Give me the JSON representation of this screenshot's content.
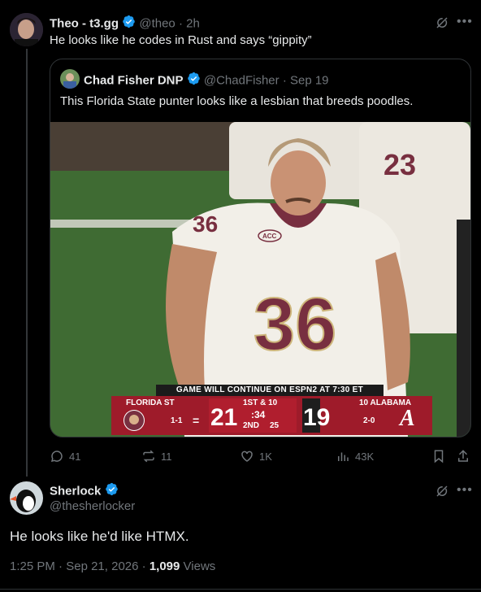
{
  "post": {
    "author_name": "Theo - t3.gg",
    "author_handle": "@theo",
    "separator": "·",
    "time": "2h",
    "text": "He looks like he codes in Rust and says “gippity”",
    "quote": {
      "author_name": "Chad Fisher DNP",
      "author_handle": "@ChadFisher",
      "separator": "·",
      "date": "Sep 19",
      "text": "This Florida State punter looks like a lesbian that breeds poodles.",
      "image": {
        "jersey_number": "36",
        "back_jersey_number": "23",
        "sleeve_number": "36",
        "patch": "ACC",
        "banner": "GAME WILL CONTINUE ON ESPN2 AT 7:30 ET",
        "scoreboard": {
          "home_team": "FLORIDA ST",
          "home_record": "1-1",
          "home_score": "21",
          "quarter": "1ST & 10",
          "clock": ":34",
          "period": "2ND",
          "play_clock": "25",
          "away_score": "19",
          "away_team": "10 ALABAMA",
          "away_record": "2-0",
          "away_logo_letter": "A"
        }
      }
    },
    "actions": {
      "replies": "41",
      "reposts": "11",
      "likes": "1K",
      "views": "43K"
    }
  },
  "reply": {
    "author_name": "Sherlock",
    "author_handle": "@thesherlocker",
    "text": "He looks like he'd like HTMX.",
    "time": "1:25 PM",
    "date": "Sep 21, 2026",
    "views_count": "1,099",
    "views_label": "Views",
    "separator": "·"
  },
  "colors": {
    "background": "#000000",
    "verified": "#1d9bf0",
    "text": "#e7e9ea",
    "muted": "#71767b",
    "fsu_garnet": "#782f40",
    "scoreboard_red": "#c8102e"
  }
}
